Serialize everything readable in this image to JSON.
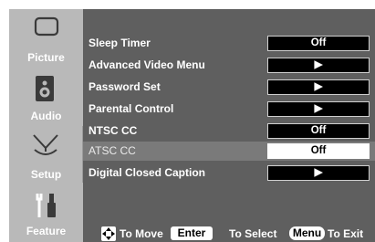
{
  "sidebar": {
    "tabs": [
      {
        "label": "Picture",
        "icon": "tv-screen-icon",
        "active": false
      },
      {
        "label": "Audio",
        "icon": "speaker-icon",
        "active": false
      },
      {
        "label": "Setup",
        "icon": "satellite-dish-icon",
        "active": true
      },
      {
        "label": "Feature",
        "icon": "tools-icon",
        "active": false
      }
    ]
  },
  "menu": {
    "items": [
      {
        "label": "Sleep Timer",
        "value": "Off"
      },
      {
        "label": "Advanced Video Menu",
        "value": "▶"
      },
      {
        "label": "Password Set",
        "value": "▶"
      },
      {
        "label": "Parental Control",
        "value": "▶"
      },
      {
        "label": "NTSC CC",
        "value": "Off"
      },
      {
        "label": "ATSC CC",
        "value": "Off",
        "selected": true
      },
      {
        "label": "Digital Closed Caption",
        "value": "▶"
      }
    ]
  },
  "helpbar": {
    "move_text": "To Move",
    "enter_label": "Enter",
    "select_text": "To Select",
    "menu_label": "Menu",
    "exit_text": "To Exit"
  },
  "colors": {
    "background": "#5f5f5f",
    "sidebar": "#b9b9b9",
    "selected_row": "#7a7a7a"
  }
}
